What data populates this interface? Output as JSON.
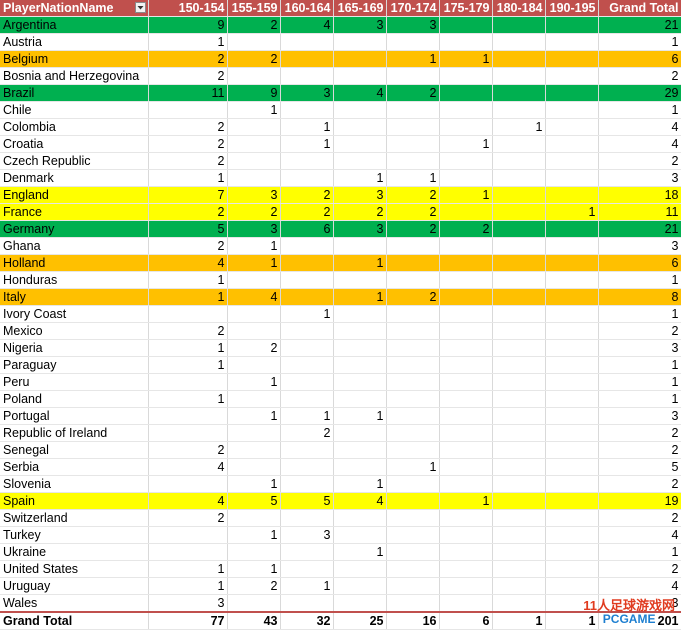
{
  "header": {
    "row_label": "PlayerNationName",
    "columns": [
      "150-154",
      "155-159",
      "160-164",
      "165-169",
      "170-174",
      "175-179",
      "180-184",
      "190-195",
      "Grand Total"
    ]
  },
  "rows": [
    {
      "name": "Argentina",
      "highlight": "green",
      "values": [
        "9",
        "2",
        "4",
        "3",
        "3",
        "",
        "",
        "",
        "21"
      ]
    },
    {
      "name": "Austria",
      "highlight": "",
      "values": [
        "1",
        "",
        "",
        "",
        "",
        "",
        "",
        "",
        "1"
      ]
    },
    {
      "name": "Belgium",
      "highlight": "orange",
      "values": [
        "2",
        "2",
        "",
        "",
        "1",
        "1",
        "",
        "",
        "6"
      ]
    },
    {
      "name": "Bosnia and Herzegovina",
      "highlight": "",
      "values": [
        "2",
        "",
        "",
        "",
        "",
        "",
        "",
        "",
        "2"
      ]
    },
    {
      "name": "Brazil",
      "highlight": "green",
      "values": [
        "11",
        "9",
        "3",
        "4",
        "2",
        "",
        "",
        "",
        "29"
      ]
    },
    {
      "name": "Chile",
      "highlight": "",
      "values": [
        "",
        "1",
        "",
        "",
        "",
        "",
        "",
        "",
        "1"
      ]
    },
    {
      "name": "Colombia",
      "highlight": "",
      "values": [
        "2",
        "",
        "1",
        "",
        "",
        "",
        "1",
        "",
        "4"
      ]
    },
    {
      "name": "Croatia",
      "highlight": "",
      "values": [
        "2",
        "",
        "1",
        "",
        "",
        "1",
        "",
        "",
        "4"
      ]
    },
    {
      "name": "Czech Republic",
      "highlight": "",
      "values": [
        "2",
        "",
        "",
        "",
        "",
        "",
        "",
        "",
        "2"
      ]
    },
    {
      "name": "Denmark",
      "highlight": "",
      "values": [
        "1",
        "",
        "",
        "1",
        "1",
        "",
        "",
        "",
        "3"
      ]
    },
    {
      "name": "England",
      "highlight": "yellow",
      "values": [
        "7",
        "3",
        "2",
        "3",
        "2",
        "1",
        "",
        "",
        "18"
      ]
    },
    {
      "name": "France",
      "highlight": "yellow",
      "values": [
        "2",
        "2",
        "2",
        "2",
        "2",
        "",
        "",
        "1",
        "11"
      ]
    },
    {
      "name": "Germany",
      "highlight": "green",
      "values": [
        "5",
        "3",
        "6",
        "3",
        "2",
        "2",
        "",
        "",
        "21"
      ]
    },
    {
      "name": "Ghana",
      "highlight": "",
      "values": [
        "2",
        "1",
        "",
        "",
        "",
        "",
        "",
        "",
        "3"
      ]
    },
    {
      "name": "Holland",
      "highlight": "orange",
      "values": [
        "4",
        "1",
        "",
        "1",
        "",
        "",
        "",
        "",
        "6"
      ]
    },
    {
      "name": "Honduras",
      "highlight": "",
      "values": [
        "1",
        "",
        "",
        "",
        "",
        "",
        "",
        "",
        "1"
      ]
    },
    {
      "name": "Italy",
      "highlight": "orange",
      "values": [
        "1",
        "4",
        "",
        "1",
        "2",
        "",
        "",
        "",
        "8"
      ]
    },
    {
      "name": "Ivory Coast",
      "highlight": "",
      "values": [
        "",
        "",
        "1",
        "",
        "",
        "",
        "",
        "",
        "1"
      ]
    },
    {
      "name": "Mexico",
      "highlight": "",
      "values": [
        "2",
        "",
        "",
        "",
        "",
        "",
        "",
        "",
        "2"
      ]
    },
    {
      "name": "Nigeria",
      "highlight": "",
      "values": [
        "1",
        "2",
        "",
        "",
        "",
        "",
        "",
        "",
        "3"
      ]
    },
    {
      "name": "Paraguay",
      "highlight": "",
      "values": [
        "1",
        "",
        "",
        "",
        "",
        "",
        "",
        "",
        "1"
      ]
    },
    {
      "name": "Peru",
      "highlight": "",
      "values": [
        "",
        "1",
        "",
        "",
        "",
        "",
        "",
        "",
        "1"
      ]
    },
    {
      "name": "Poland",
      "highlight": "",
      "values": [
        "1",
        "",
        "",
        "",
        "",
        "",
        "",
        "",
        "1"
      ]
    },
    {
      "name": "Portugal",
      "highlight": "",
      "values": [
        "",
        "1",
        "1",
        "1",
        "",
        "",
        "",
        "",
        "3"
      ]
    },
    {
      "name": "Republic of Ireland",
      "highlight": "",
      "values": [
        "",
        "",
        "2",
        "",
        "",
        "",
        "",
        "",
        "2"
      ]
    },
    {
      "name": "Senegal",
      "highlight": "",
      "values": [
        "2",
        "",
        "",
        "",
        "",
        "",
        "",
        "",
        "2"
      ]
    },
    {
      "name": "Serbia",
      "highlight": "",
      "values": [
        "4",
        "",
        "",
        "",
        "1",
        "",
        "",
        "",
        "5"
      ]
    },
    {
      "name": "Slovenia",
      "highlight": "",
      "values": [
        "",
        "1",
        "",
        "1",
        "",
        "",
        "",
        "",
        "2"
      ]
    },
    {
      "name": "Spain",
      "highlight": "yellow",
      "values": [
        "4",
        "5",
        "5",
        "4",
        "",
        "1",
        "",
        "",
        "19"
      ]
    },
    {
      "name": "Switzerland",
      "highlight": "",
      "values": [
        "2",
        "",
        "",
        "",
        "",
        "",
        "",
        "",
        "2"
      ]
    },
    {
      "name": "Turkey",
      "highlight": "",
      "values": [
        "",
        "1",
        "3",
        "",
        "",
        "",
        "",
        "",
        "4"
      ]
    },
    {
      "name": "Ukraine",
      "highlight": "",
      "values": [
        "",
        "",
        "",
        "1",
        "",
        "",
        "",
        "",
        "1"
      ]
    },
    {
      "name": "United States",
      "highlight": "",
      "values": [
        "1",
        "1",
        "",
        "",
        "",
        "",
        "",
        "",
        "2"
      ]
    },
    {
      "name": "Uruguay",
      "highlight": "",
      "values": [
        "1",
        "2",
        "1",
        "",
        "",
        "",
        "",
        "",
        "4"
      ]
    },
    {
      "name": "Wales",
      "highlight": "",
      "values": [
        "3",
        "",
        "",
        "",
        "",
        "",
        "",
        "",
        "3"
      ]
    }
  ],
  "total": {
    "name": "Grand Total",
    "values": [
      "77",
      "43",
      "32",
      "25",
      "16",
      "6",
      "1",
      "1",
      "201"
    ]
  },
  "watermark": {
    "text": "11人足球游戏网",
    "logo": "PCGAME"
  },
  "colors": {
    "header": "#c0504d",
    "green": "#00b050",
    "orange": "#ffc000",
    "yellow": "#ffff00"
  }
}
